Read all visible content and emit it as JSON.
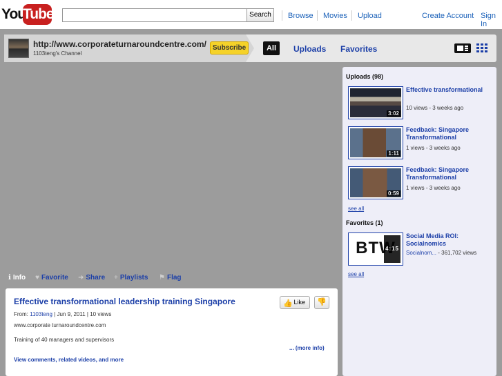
{
  "masthead": {
    "logo_you": "You",
    "logo_tube": "Tube",
    "search_placeholder": "",
    "search_button": "Search",
    "nav": {
      "browse": "Browse",
      "movies": "Movies",
      "upload": "Upload",
      "create_account": "Create Account",
      "sign_in": "Sign In"
    }
  },
  "channel": {
    "url": "http://www.corporateturnaroundcentre.com/",
    "name": "1103teng's Channel",
    "subscribe": "Subscribe",
    "tabs": {
      "all": "All",
      "uploads": "Uploads",
      "favorites": "Favorites"
    }
  },
  "actions": {
    "info": "Info",
    "favorite": "Favorite",
    "share": "Share",
    "playlists": "Playlists",
    "flag": "Flag"
  },
  "video": {
    "title": "Effective transformational leadership training Singapore",
    "like": "Like",
    "from_label": "From:",
    "author": "1103teng",
    "date": "| Jun 9, 2011",
    "views": "| 10 views",
    "website": "www.corporate turnaroundcentre.com",
    "description": "Training of 40 managers and supervisors",
    "more_info": "... (more info)",
    "view_comments": "View comments, related videos, and more"
  },
  "sidebar": {
    "uploads_heading": "Uploads (98)",
    "uploads": [
      {
        "title": "Effective transformational",
        "stats": "10 views - 3 weeks ago",
        "duration": "3:02"
      },
      {
        "title": "Feedback: Singapore Transformational",
        "stats": "1 views - 3 weeks ago",
        "duration": "1:11"
      },
      {
        "title": "Feedback: Singapore Transformational",
        "stats": "1 views - 3 weeks ago",
        "duration": "0:59"
      }
    ],
    "see_all_uploads": "see all",
    "favorites_heading": "Favorites (1)",
    "favorites": [
      {
        "title": "Social Media ROI: Socialnomics",
        "stats_author": "Socialnom...",
        "stats_views": "- 361,702 views",
        "duration": "4:15",
        "thumb_text": "BTW"
      }
    ],
    "see_all_favorites": "see all"
  }
}
